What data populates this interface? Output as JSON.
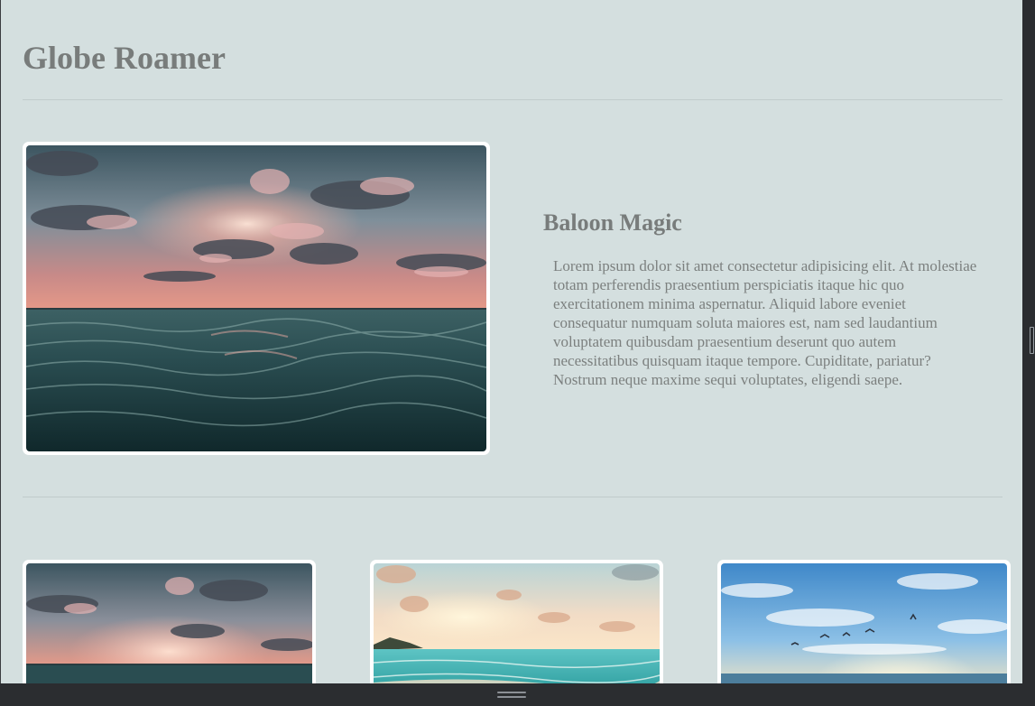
{
  "site": {
    "title": "Globe Roamer"
  },
  "feature": {
    "heading": "Baloon Magic",
    "body": "Lorem ipsum dolor sit amet consectetur adipisicing elit. At molestiae totam perferendis praesentium perspiciatis itaque hic quo exercitationem minima aspernatur. Aliquid labore eveniet consequatur numquam soluta maiores est, nam sed laudantium voluptatem quibusdam praesentium deserunt quo autem necessitatibus quisquam itaque tempore. Cupiditate, pariatur? Nostrum neque maxime sequi voluptates, eligendi saepe.",
    "image_icon": "ocean-sunset-photo"
  },
  "gallery": {
    "cards": [
      {
        "image_icon": "ocean-sunset-photo"
      },
      {
        "image_icon": "beach-sunrise-photo"
      },
      {
        "image_icon": "sky-birds-photo"
      }
    ]
  },
  "colors": {
    "page_background": "#d4dfdf",
    "heading_text": "#787c7b",
    "body_text": "#7c807f",
    "frame": "#ffffff",
    "chrome": "#2b2d30"
  }
}
